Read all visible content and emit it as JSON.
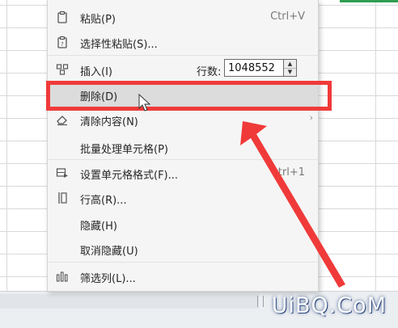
{
  "menu": {
    "items": [
      {
        "label": "粘贴(P)",
        "shortcut": "Ctrl+V",
        "icon": "paste-icon"
      },
      {
        "label": "选择性粘贴(S)...",
        "icon": "paste-special-icon"
      },
      {
        "label": "插入(I)",
        "icon": "insert-icon"
      },
      {
        "label": "删除(D)"
      },
      {
        "label": "清除内容(N)",
        "icon": "eraser-icon"
      },
      {
        "label": "批量处理单元格(P)"
      },
      {
        "label": "设置单元格格式(F)...",
        "shortcut": "trl+1",
        "icon": "format-cells-icon"
      },
      {
        "label": "行高(R)...",
        "icon": "row-height-icon"
      },
      {
        "label": "隐藏(H)"
      },
      {
        "label": "取消隐藏(U)"
      },
      {
        "label": "筛选列(L)...",
        "icon": "filter-columns-icon"
      }
    ],
    "insert_rows": {
      "label": "行数:",
      "value": "1048552"
    }
  },
  "watermark": "UiBQ.CoM",
  "colors": {
    "highlight": "#f03a3a",
    "arrow": "#f03a3a",
    "menu_bg": "#f5f5f5",
    "hover_bg": "#dcdcdc"
  }
}
